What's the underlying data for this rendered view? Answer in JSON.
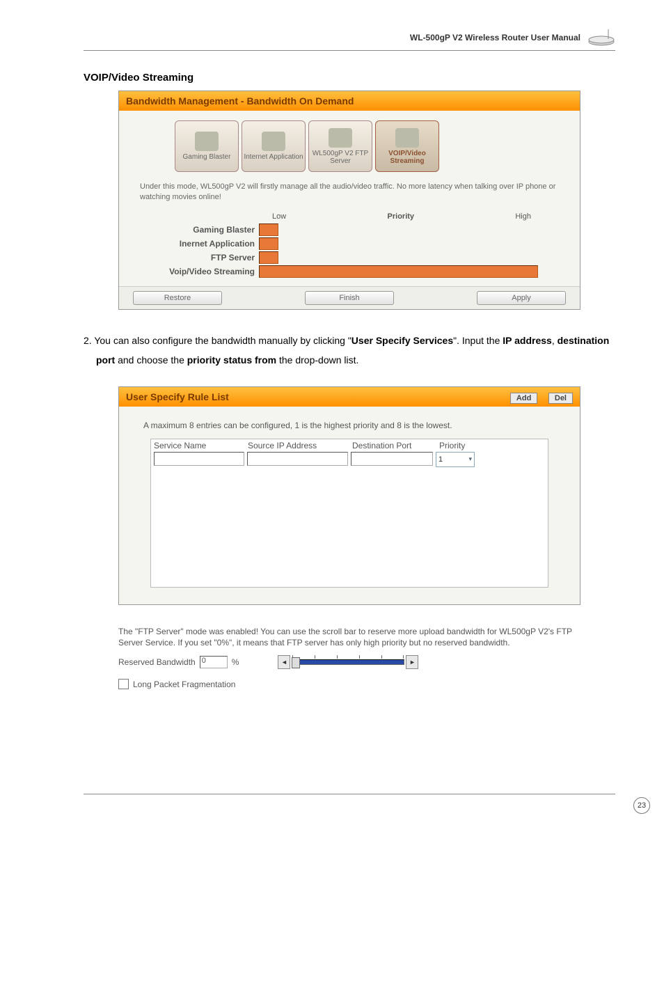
{
  "header": {
    "manual_title": "WL-500gP V2 Wireless Router User Manual"
  },
  "section": {
    "title": "VOIP/Video Streaming"
  },
  "panel1": {
    "title": "Bandwidth Management - Bandwidth On Demand",
    "modes": {
      "gaming": "Gaming Blaster",
      "internet": "Internet Application",
      "ftp": "WL500gP V2 FTP Server",
      "voip": "VOIP/Video Streaming"
    },
    "description": "Under this mode, WL500gP V2 will firstly manage all the audio/video traffic. No more latency when talking over IP phone or watching movies online!",
    "priority": {
      "header": {
        "low": "Low",
        "label": "Priority",
        "high": "High"
      },
      "rows": {
        "gaming": "Gaming Blaster",
        "internet": "Inernet Application",
        "ftp": "FTP Server",
        "voip": "Voip/Video Streaming"
      }
    },
    "buttons": {
      "restore": "Restore",
      "finish": "Finish",
      "apply": "Apply"
    }
  },
  "step2": {
    "num": "2.",
    "line1": "You can also configure the bandwidth manually by clicking \"",
    "strong1": "User Specify Services",
    "mid1": "\". Input the ",
    "strong2": "IP address",
    "mid2": ", ",
    "strong3": "destination port",
    "mid3": " and choose the ",
    "strong4": "priority status from",
    "tail": " the drop-down list."
  },
  "panel2": {
    "title": "User Specify Rule List",
    "buttons": {
      "add": "Add",
      "del": "Del"
    },
    "note": "A maximum 8 entries can be configured, 1 is the highest priority and 8 is the lowest.",
    "columns": {
      "service": "Service Name",
      "source": "Source IP Address",
      "dest": "Destination Port",
      "priority": "Priority"
    },
    "priority_value": "1"
  },
  "ftp": {
    "description": "The \"FTP Server\" mode was enabled! You can use the scroll bar to reserve more upload bandwidth for WL500gP V2's FTP Server Service. If you set \"0%\", it means that FTP server has only high priority but no reserved bandwidth.",
    "reserved_label": "Reserved Bandwidth",
    "reserved_value": "0",
    "percent": "%",
    "long_packet": "Long Packet Fragmentation"
  },
  "page_number": "23"
}
